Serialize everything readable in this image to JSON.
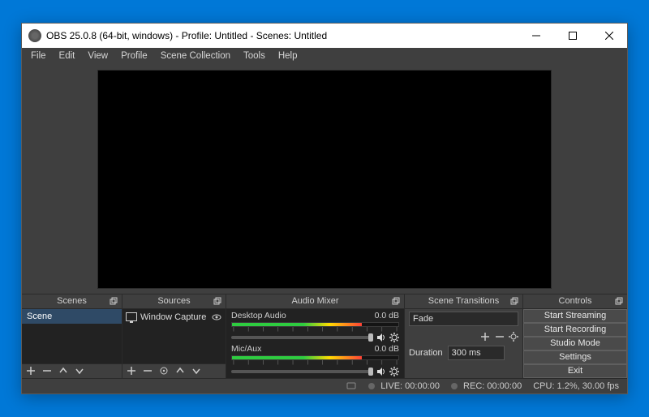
{
  "window": {
    "title": "OBS 25.0.8 (64-bit, windows) - Profile: Untitled - Scenes: Untitled"
  },
  "menu": {
    "file": "File",
    "edit": "Edit",
    "view": "View",
    "profile": "Profile",
    "scene_collection": "Scene Collection",
    "tools": "Tools",
    "help": "Help"
  },
  "docks": {
    "scenes_title": "Scenes",
    "sources_title": "Sources",
    "mixer_title": "Audio Mixer",
    "transitions_title": "Scene Transitions",
    "controls_title": "Controls"
  },
  "scenes": {
    "items": [
      "Scene"
    ]
  },
  "sources": {
    "items": [
      {
        "name": "Window Capture"
      }
    ]
  },
  "mixer": {
    "channels": [
      {
        "name": "Desktop Audio",
        "level_db": "0.0 dB"
      },
      {
        "name": "Mic/Aux",
        "level_db": "0.0 dB"
      }
    ]
  },
  "transitions": {
    "selected": "Fade",
    "duration_label": "Duration",
    "duration_value": "300 ms"
  },
  "controls": {
    "start_streaming": "Start Streaming",
    "start_recording": "Start Recording",
    "studio_mode": "Studio Mode",
    "settings": "Settings",
    "exit": "Exit"
  },
  "status": {
    "live_label": "LIVE:",
    "live_time": "00:00:00",
    "rec_label": "REC:",
    "rec_time": "00:00:00",
    "cpu": "CPU: 1.2%, 30.00 fps"
  }
}
